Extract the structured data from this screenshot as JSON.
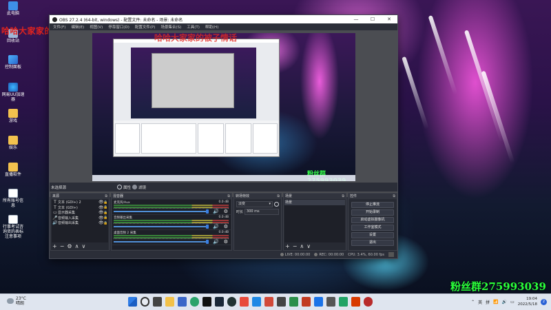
{
  "desktop": {
    "icons": [
      {
        "label": "此电脑"
      },
      {
        "label": "回收站"
      },
      {
        "label": "控制面板"
      },
      {
        "label": "网易UU加速器"
      },
      {
        "label": "游戏"
      },
      {
        "label": "娱乐"
      },
      {
        "label": "直播软件"
      },
      {
        "label": "所有账号信息"
      },
      {
        "label": "行事考试咨询资的表标注意事项"
      }
    ],
    "watermark_top_left": "哈哈大家家的被子情话",
    "watermark_bottom_right": "粉丝群275993039"
  },
  "obs": {
    "window_title": "OBS 27.2.4 (64-bit, windows) - 配置文件: 未命名 - 场景: 未命名",
    "window_controls": [
      "—",
      "☐",
      "✕"
    ],
    "menu": [
      "文件(F)",
      "编辑(E)",
      "视图(V)",
      "停靠窗口(D)",
      "配置文件(P)",
      "场景集合(S)",
      "工具(T)",
      "帮助(H)"
    ],
    "preview": {
      "watermark": "粉丝群275993039",
      "overlay_text": "哈哈大家家的被子情话"
    },
    "context_bar": {
      "source_label": "未选择源",
      "properties_label": "属性",
      "filters_label": "滤镜"
    },
    "sources_dock": {
      "title": "来源",
      "items": [
        {
          "icon": "T",
          "name": "文本 (GDI+) 2"
        },
        {
          "icon": "T",
          "name": "文本 (GDI+)"
        },
        {
          "icon": "▭",
          "name": "显示器采集"
        },
        {
          "icon": "🎤",
          "name": "音频输入采集"
        },
        {
          "icon": "🔊",
          "name": "音频输出采集"
        }
      ],
      "footer": [
        "+",
        "−",
        "⚙",
        "∧",
        "∨"
      ]
    },
    "mixer_dock": {
      "title": "混音器",
      "channels": [
        {
          "name": "麦克风/Aux",
          "db": "0.0 dB",
          "level": 0.95
        },
        {
          "name": "音频输出采集",
          "db": "0.0 dB",
          "level": 0.95
        },
        {
          "name": "桌面音频 2 采集",
          "db": "0.0 dB",
          "level": 0.95
        }
      ]
    },
    "transitions_dock": {
      "title": "转场特效",
      "transition": "淡变",
      "duration_label": "时长",
      "duration_value": "300 ms"
    },
    "scenes_dock": {
      "title": "场景",
      "items": [
        "场景"
      ],
      "footer": [
        "+",
        "−",
        "∧",
        "∨"
      ]
    },
    "controls_dock": {
      "title": "控件",
      "buttons": [
        "停止推流",
        "开始录制",
        "启动虚拟摄像机",
        "工作室模式",
        "设置",
        "退出"
      ]
    },
    "status": {
      "live": "LIVE: 00:00:00",
      "rec": "REC: 00:00:00",
      "cpu": "CPU: 3.4%, 60.00 fps"
    }
  },
  "taskbar": {
    "temperature": "23°C",
    "weather": "晴朗",
    "lang": "英",
    "ime": "拼",
    "time": "19:04",
    "date": "2022/5/18",
    "notifications": "2"
  }
}
